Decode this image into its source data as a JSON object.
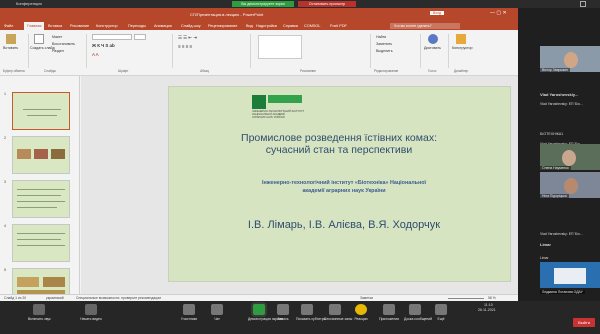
{
  "conference": {
    "window_title": "Конференция",
    "share_status": "Вы демонстрируете экран",
    "stop_button": "Остановить просмотр"
  },
  "ppt": {
    "doc_title": "СП/Презентация.в.лекцию  -  PowerPoint",
    "signin_button": "Вход",
    "tabs": [
      "Файл",
      "Главная",
      "Вставка",
      "Рисование",
      "Конструктор",
      "Переходы",
      "Анимация",
      "Слайд-шоу",
      "Рецензирование",
      "Вид",
      "Надстройки",
      "Справка",
      "COMSOL",
      "Foxit PDF"
    ],
    "search_placeholder": "Что вы хотите сделать?",
    "ribbon": {
      "paste": "Вставить",
      "new_slide": "Создать слайд",
      "layout": "Макет",
      "reset": "Восстановить",
      "section": "Раздел",
      "font_name": "",
      "font_size": "",
      "find": "Найти",
      "replace": "Заменить",
      "select": "Выделить",
      "dictation": "Диктовать",
      "designer": "Конструктор",
      "groups": [
        "Буфер обмена",
        "Слайды",
        "Шрифт",
        "Абзац",
        "Рисование",
        "Редактирование",
        "Голос",
        "Дизайнер"
      ]
    },
    "slide": {
      "logo_text": "ІНЖЕНЕРНО-ТЕХНОЛОГІЧНИЙ ІНСТИТУТ",
      "logo_sub1": "НАЦІОНАЛЬНОЇ АКАДЕМІЇ",
      "logo_sub2": "АГРАРНИХ НАУК УКРАЇНИ",
      "title_line1": "Промислове розведення їстівних комах:",
      "title_line2": "сучасний стан та перспективи",
      "institute_line1": "Інженерно-технологічний інститут «Біотехніка» Національної",
      "institute_line2": "академії аграрних наук України",
      "authors": "І.В. Лімарь, І.В. Алієва, В.Я. Ходорчук"
    },
    "thumb_numbers": [
      "1",
      "2",
      "3",
      "4",
      "5",
      "6"
    ],
    "status": {
      "slide_counter": "Слайд 1 из 20",
      "language": "украинский",
      "accessibility": "Специальные возможности: проверьте рекомендации",
      "notes": "Заметки",
      "zoom": "58 %"
    }
  },
  "participants": {
    "labels": [
      "Віктор Зварыкин",
      "Vlad Yaroshevskiy...",
      "Vlad Yaroshevsky: ЕП 'Біо...",
      "БІОТЕХНІКА1",
      "Vlad Yaroshevsky: ЕП 'Біо...",
      "Олена Науменко",
      "Ніна Підоріцька",
      "Vlad Yaroshevsky: ЕП 'Біо...",
      "Limar",
      "Limar",
      "Людмила Потапова ОДАУ"
    ]
  },
  "taskbar": {
    "items": [
      "Включить звук",
      "Начать видео",
      "Участники",
      "Чат",
      "Демонстрация экрана",
      "Запись",
      "Показать субтитры",
      "Сессионные залы",
      "Реакции",
      "Приложения",
      "Доска сообщений",
      "Ещё"
    ],
    "leave_button": "Выйти",
    "time": "11:10",
    "date": "26.11.2021"
  },
  "colors": {
    "ppt_accent": "#b7472a",
    "slide_background": "#d7e4c1",
    "title_color": "#2f4d6f",
    "institute_color": "#3b5d8f",
    "share_green": "#2e9d3f",
    "stop_red": "#b8322b"
  }
}
